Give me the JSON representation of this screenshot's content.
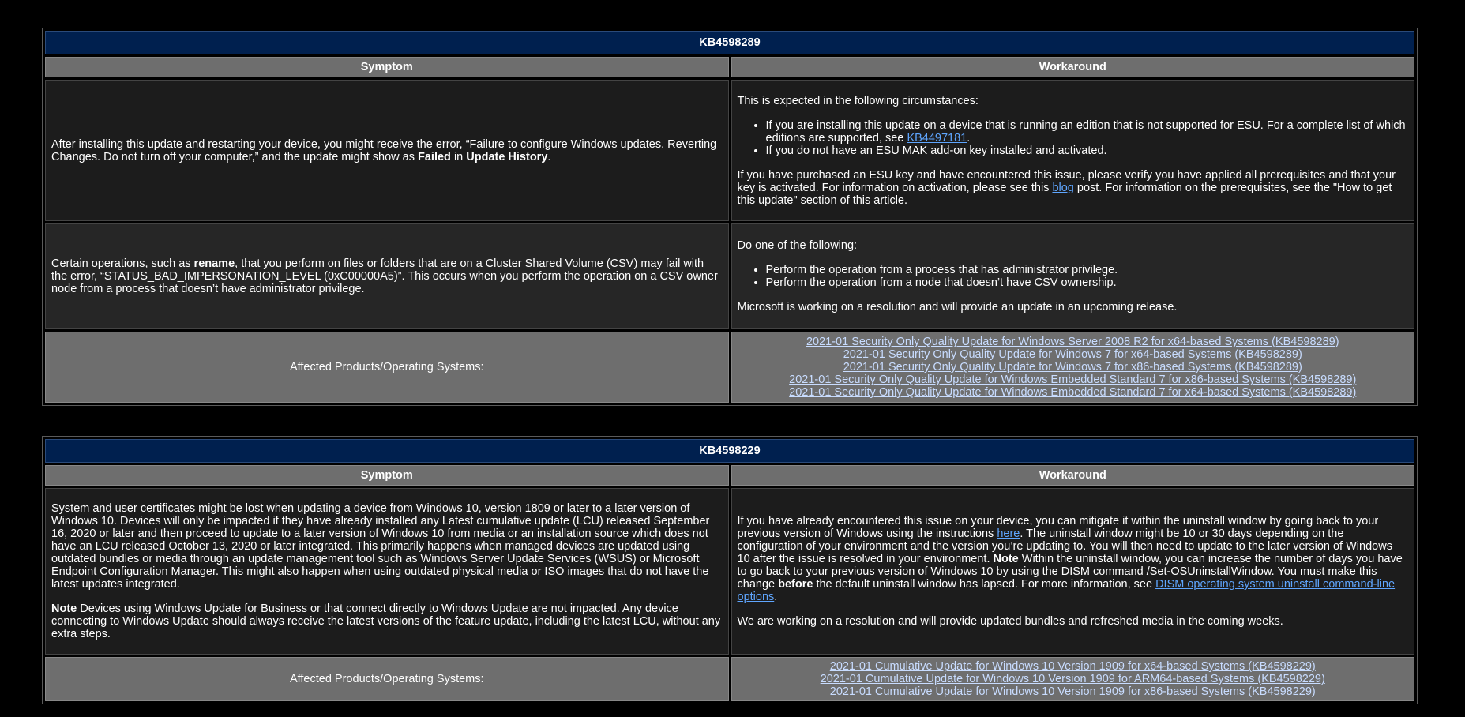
{
  "tables": [
    {
      "kb": "KB4598289",
      "symptom_header": "Symptom",
      "workaround_header": "Workaround",
      "row1": {
        "symptom_pre": "After installing this update and restarting your device, you might receive the error, “Failure to configure Windows updates. Reverting Changes. Do not turn off your computer,” and the update might show as ",
        "symptom_b1": "Failed",
        "symptom_mid": " in ",
        "symptom_b2": "Update History",
        "symptom_post": ".",
        "wa_intro": "This is expected in the following circumstances:",
        "wa_bullet1_pre": "If you are installing this update on a device that is running an edition that is not supported for ESU. For a complete list of which editions are supported, see ",
        "wa_bullet1_link": "KB4497181",
        "wa_bullet1_post": ".",
        "wa_bullet2": "If you do not have an ESU MAK add-on key installed and activated.",
        "wa_para_pre": "If you have purchased an ESU key and have encountered this issue, please verify you have applied all prerequisites and that your key is activated. For information on activation, please see this ",
        "wa_para_link": "blog",
        "wa_para_post": " post. For information on the prerequisites, see the \"How to get this update\" section of this article."
      },
      "row2": {
        "symptom_pre": "Certain operations, such as ",
        "symptom_b1": "rename",
        "symptom_post": ", that you perform on files or folders that are on a Cluster Shared Volume (CSV) may fail with the error, “STATUS_BAD_IMPERSONATION_LEVEL (0xC00000A5)”. This occurs when you perform the operation on a CSV owner node from a process that doesn’t have administrator privilege.",
        "wa_intro": "Do one of the following:",
        "wa_bullet1": "Perform the operation from a process that has administrator privilege.",
        "wa_bullet2": "Perform the operation from a node that doesn’t have CSV ownership.",
        "wa_para": "Microsoft is working on a resolution and will provide an update in an upcoming release."
      },
      "affected_label": "Affected Products/Operating Systems:",
      "affected_links": [
        "2021-01 Security Only Quality Update for Windows Server 2008 R2 for x64-based Systems (KB4598289)",
        "2021-01 Security Only Quality Update for Windows 7 for x64-based Systems (KB4598289)",
        "2021-01 Security Only Quality Update for Windows 7 for x86-based Systems (KB4598289)",
        "2021-01 Security Only Quality Update for Windows Embedded Standard 7 for x86-based Systems (KB4598289)",
        "2021-01 Security Only Quality Update for Windows Embedded Standard 7 for x64-based Systems (KB4598289)"
      ]
    },
    {
      "kb": "KB4598229",
      "symptom_header": "Symptom",
      "workaround_header": "Workaround",
      "row1": {
        "symptom_p1": "System and user certificates might be lost when updating a device from Windows 10, version 1809 or later to a later version of Windows 10. Devices will only be impacted if they have already installed any Latest cumulative update (LCU) released September 16, 2020 or later and then proceed to update to a later version of Windows 10 from media or an installation source which does not have an LCU released October 13, 2020 or later integrated. This primarily happens when managed devices are updated using outdated bundles or media through an update management tool such as Windows Server Update Services (WSUS) or Microsoft Endpoint Configuration Manager. This might also happen when using outdated physical media or ISO images that do not have the latest updates integrated.",
        "symptom_note_b": "Note",
        "symptom_note": " Devices using Windows Update for Business or that connect directly to Windows Update are not impacted. Any device connecting to Windows Update should always receive the latest versions of the feature update, including the latest LCU, without any extra steps.",
        "wa_p1_a": "If you have already encountered this issue on your device, you can mitigate it within the uninstall window by going back to your previous version of Windows using the instructions ",
        "wa_p1_link1": "here",
        "wa_p1_b": ". The uninstall window might be 10 or 30 days depending on the configuration of your environment and the version you’re updating to. You will then need to update to the later version of Windows 10 after the issue is resolved in your environment. ",
        "wa_p1_note": "Note",
        "wa_p1_c": " Within the uninstall window, you can increase the number of days you have to go back to your previous version of Windows 10 by using the DISM command /Set-OSUninstallWindow. You must make this change ",
        "wa_p1_before": "before",
        "wa_p1_d": " the default uninstall window has lapsed. For more information, see ",
        "wa_p1_link2": "DISM operating system uninstall command-line options",
        "wa_p1_e": ".",
        "wa_p2": "We are working on a resolution and will provide updated bundles and refreshed media in the coming weeks."
      },
      "affected_label": "Affected Products/Operating Systems:",
      "affected_links": [
        "2021-01 Cumulative Update for Windows 10 Version 1909 for x64-based Systems (KB4598229)",
        "2021-01 Cumulative Update for Windows 10 Version 1909 for ARM64-based Systems (KB4598229)",
        "2021-01 Cumulative Update for Windows 10 Version 1909 for x86-based Systems (KB4598229)"
      ]
    }
  ]
}
